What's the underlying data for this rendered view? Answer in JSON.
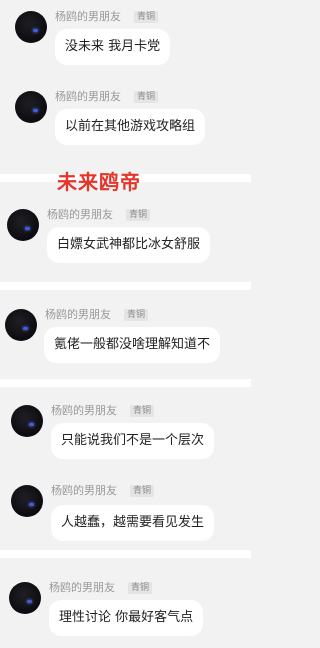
{
  "overlay_title": "未来鸥帝",
  "colors": {
    "title": "#e5342a",
    "bubble": "#ffffff",
    "background": "#f2f2f2"
  },
  "messages": [
    {
      "name": "杨鸥的男朋友",
      "badge": "青铜",
      "text": "没未来 我月卡党"
    },
    {
      "name": "杨鸥的男朋友",
      "badge": "青铜",
      "text": "以前在其他游戏攻略组"
    },
    {
      "name": "杨鸥的男朋友",
      "badge": "青铜",
      "text": "白嫖女武神都比冰女舒服"
    },
    {
      "name": "杨鸥的男朋友",
      "badge": "青铜",
      "text": "氪佬一般都没啥理解知道不"
    },
    {
      "name": "杨鸥的男朋友",
      "badge": "青铜",
      "text": "只能说我们不是一个层次"
    },
    {
      "name": "杨鸥的男朋友",
      "badge": "青铜",
      "text": "人越蠢，越需要看见发生"
    },
    {
      "name": "杨鸥的男朋友",
      "badge": "青铜",
      "text": "理性讨论 你最好客气点"
    }
  ]
}
